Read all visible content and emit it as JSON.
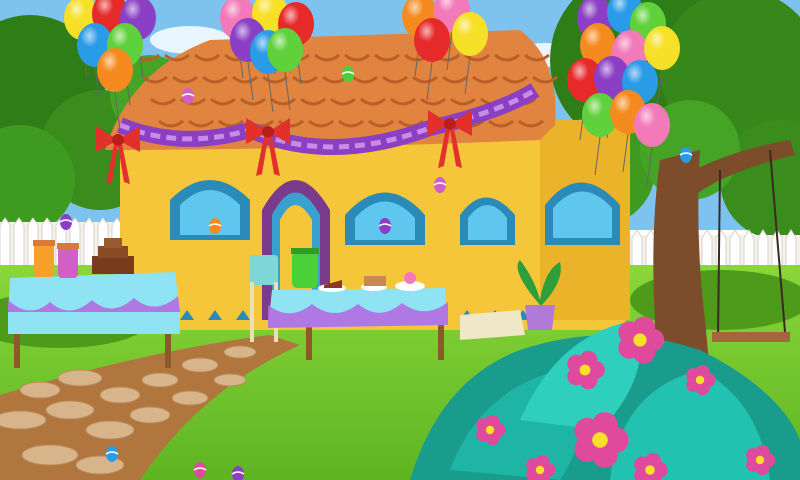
{
  "scene": {
    "colors": {
      "sky": "#7ec3f0",
      "grass": "#74c72c",
      "grass_dark": "#4e9b1c",
      "tree_dark": "#2f7d17",
      "wall": "#f6c63a",
      "roof": "#e0843f",
      "bunting_purple": "#8b3fc2",
      "bow_red": "#e2312b",
      "window_blue": "#5fc6ee",
      "tablecloth": "#8fe3f2",
      "path_stone": "#d8b48a",
      "path_bg": "#b0763e",
      "fence": "#f4f1ec",
      "trunk": "#7d4c2a",
      "leaf_teal": "#1fb5a5",
      "flower_pink": "#e04a9c"
    },
    "balloon_colors": [
      "#f7e028",
      "#e62a2a",
      "#8a3fc4",
      "#2a9be6",
      "#5fd13a",
      "#f58a1e",
      "#f27ab8"
    ],
    "icons": [
      "balloon-icon",
      "party-bow-icon",
      "easter-egg-icon",
      "cake-icon",
      "juice-jar-icon",
      "swing-icon",
      "flower-icon"
    ]
  }
}
